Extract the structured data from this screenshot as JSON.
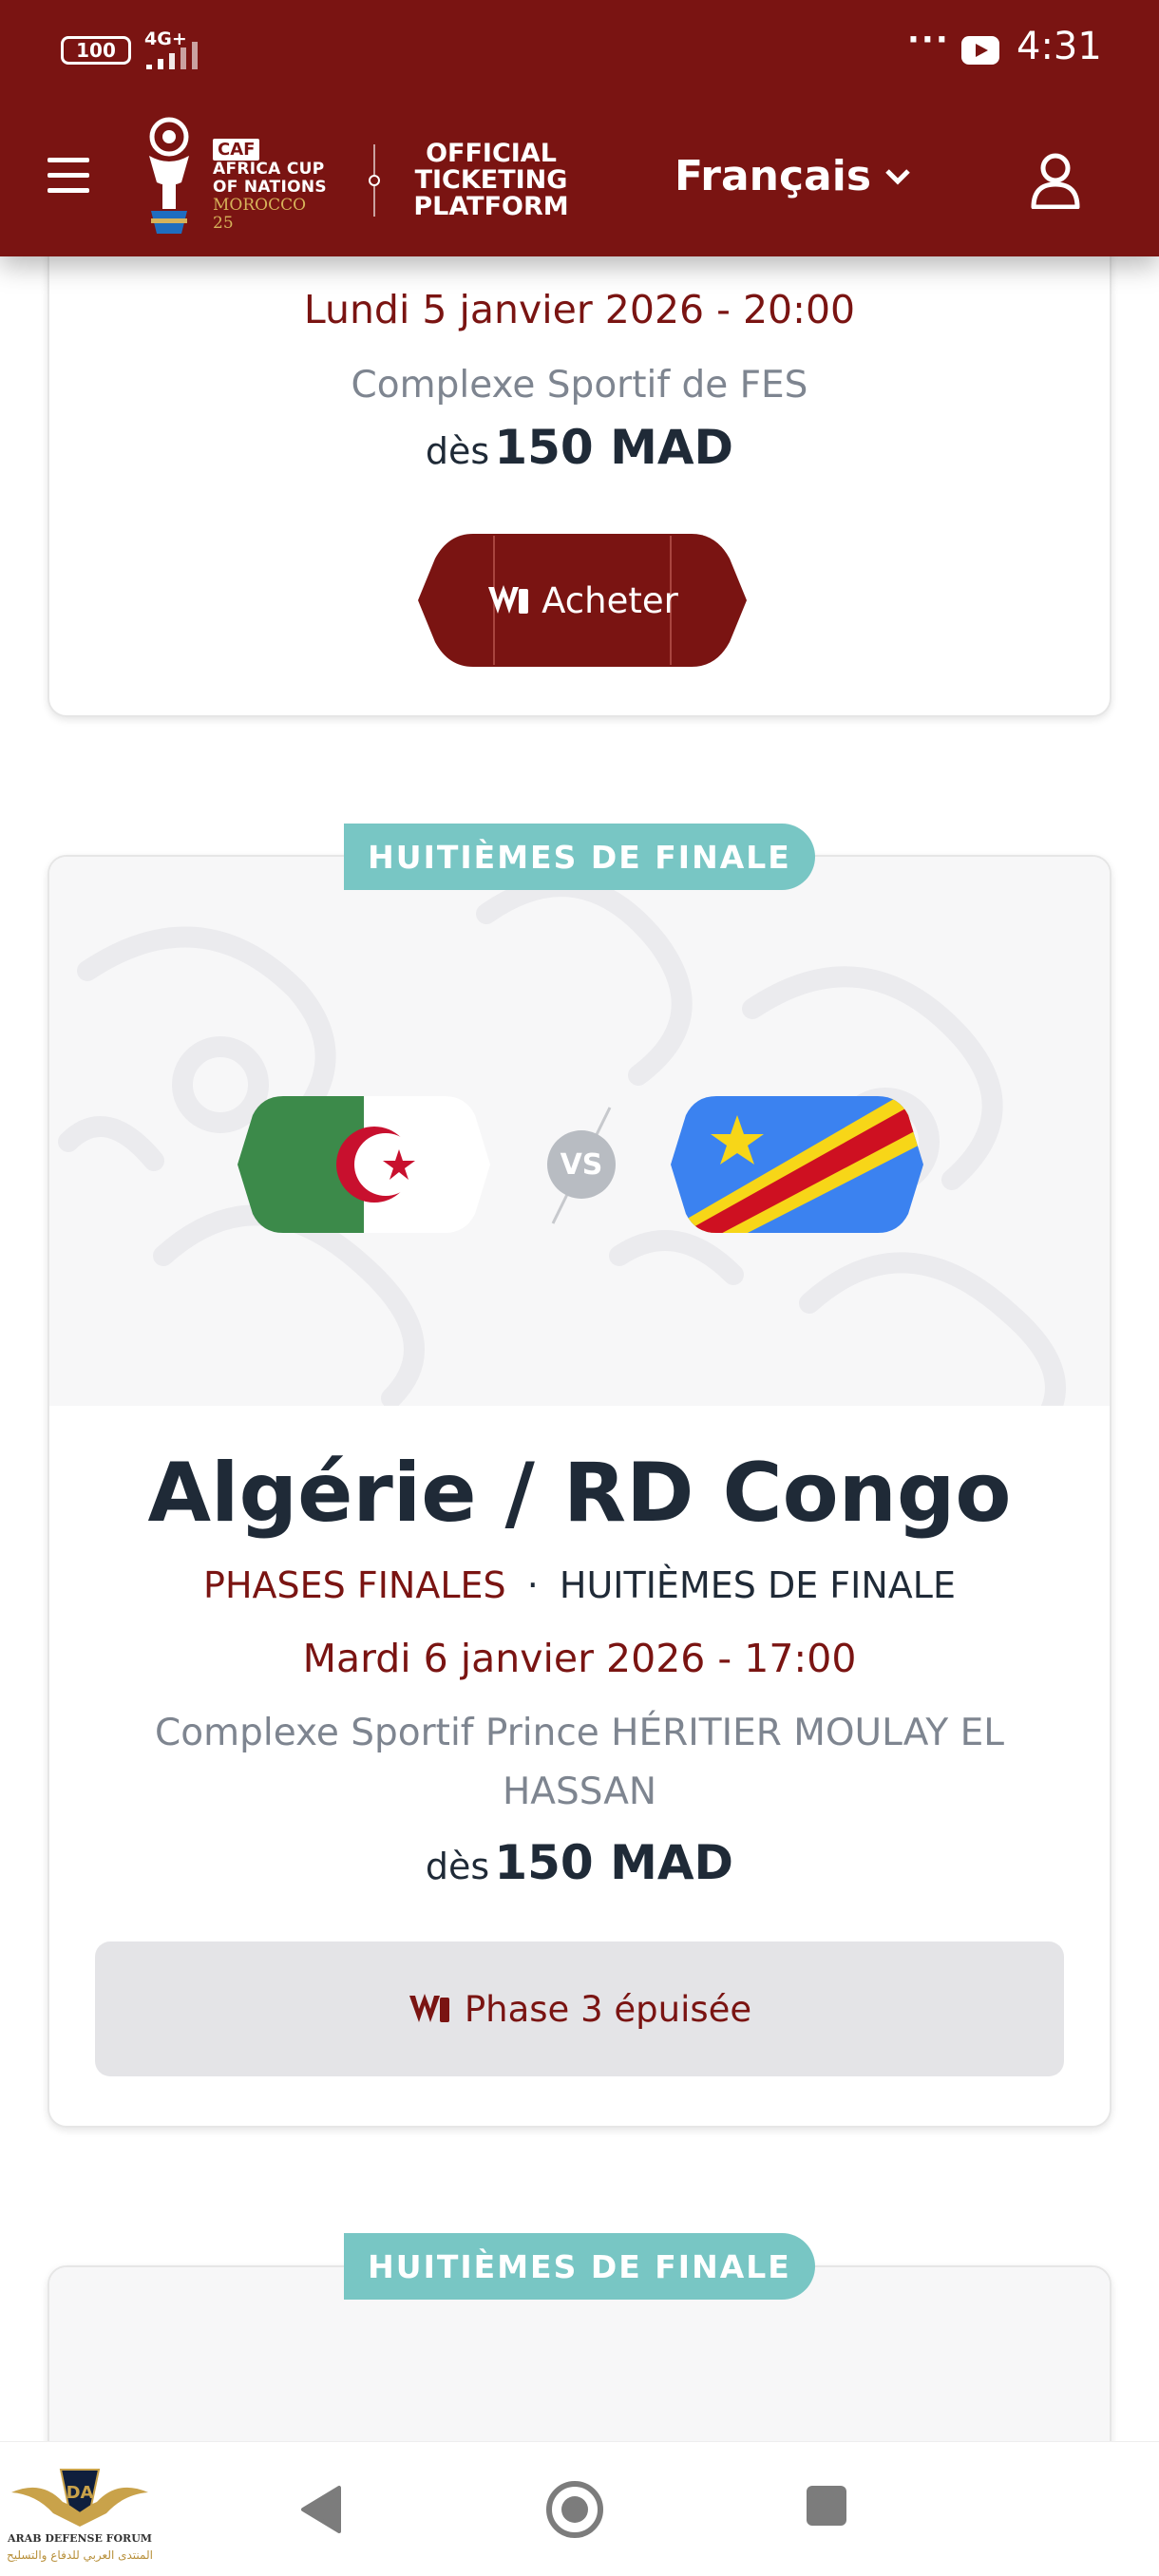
{
  "status_bar": {
    "battery": "100",
    "network": "4G+",
    "more": "···",
    "time": "4:31"
  },
  "header": {
    "menu_icon": "hamburger-menu-icon",
    "logo": {
      "caf": "CAF",
      "line1": "AFRICA CUP",
      "line2": "OF NATIONS",
      "line3": "MOROCCO 25"
    },
    "platform_title": "OFFICIAL TICKETING PLATFORM",
    "language": "Français",
    "account_icon": "user-icon"
  },
  "matches": [
    {
      "date": "Lundi 5 janvier 2026 - 20:00",
      "venue": "Complexe Sportif de FES",
      "price_prefix": "dès",
      "price": "150 MAD",
      "button_label": "Acheter"
    },
    {
      "stage_tag": "HUITIÈMES DE FINALE",
      "team_home": "Algérie",
      "team_away": "RD Congo",
      "teams_title": "Algérie / RD Congo",
      "vs": "VS",
      "phase": "PHASES FINALES",
      "separator": "·",
      "round": "HUITIÈMES DE FINALE",
      "date": "Mardi 6 janvier 2026 - 17:00",
      "venue_line1": "Complexe Sportif Prince HÉRITIER MOULAY EL",
      "venue_line2": "HASSAN",
      "price_prefix": "dès",
      "price": "150 MAD",
      "button_label": "Phase 3 épuisée"
    },
    {
      "stage_tag": "HUITIÈMES DE FINALE"
    }
  ],
  "nav_bar": {
    "back_icon": "back-triangle-icon",
    "home_icon": "home-circle-icon",
    "recents_icon": "recents-square-icon"
  },
  "watermark": {
    "line1": "DA",
    "line2": "ARAB DEFENSE FORUM",
    "line3": "المنتدى العربي للدفاع والتسليح"
  },
  "colors": {
    "brand": "#7a1412",
    "tag": "#78c6c4",
    "text_dark": "#1f2a37",
    "text_muted": "#7e8590",
    "disabled_button": "#e4e4e7"
  }
}
